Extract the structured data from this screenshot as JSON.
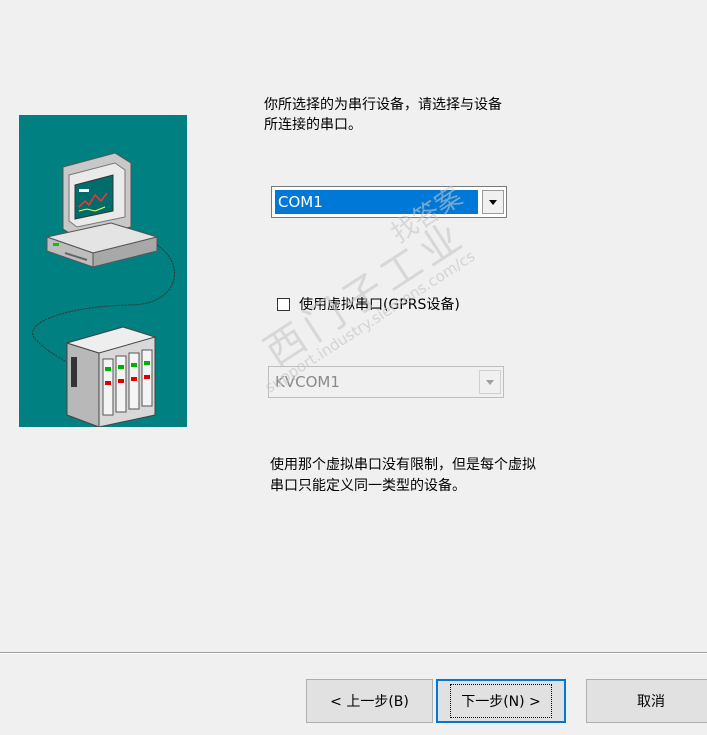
{
  "instruction_text": "你所选择的为串行设备，请选择与设备所连接的串口。",
  "instruction_lines": [
    "你所选择的为串行设备，请选择与设备",
    "所连接的串口。"
  ],
  "serial_port": {
    "selected": "COM1"
  },
  "virtual_port_checkbox": {
    "label": "使用虚拟串口(GPRS设备)",
    "checked": false
  },
  "virtual_port": {
    "selected": "KVCOM1",
    "enabled": false
  },
  "note_lines": [
    "使用那个虚拟串口没有限制，但是每个虚拟",
    "串口只能定义同一类型的设备。"
  ],
  "watermark": {
    "text_cn1": "西门子工业",
    "text_cn2": "找答案",
    "text_url": "support.industry.siemens.com/cs"
  },
  "buttons": {
    "back": "< 上一步(B)",
    "next": "下一步(N) >",
    "cancel": "取消"
  },
  "colors": {
    "illustration_bg": "#008080",
    "selection": "#0078d7"
  }
}
